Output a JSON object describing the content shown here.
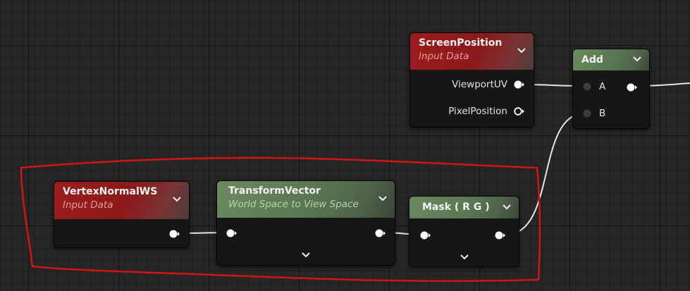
{
  "nodes": {
    "screen_position": {
      "title": "ScreenPosition",
      "subtitle": "Input Data",
      "pins": [
        "ViewportUV",
        "PixelPosition"
      ]
    },
    "add": {
      "title": "Add",
      "pins": [
        "A",
        "B"
      ]
    },
    "vertex_normal": {
      "title": "VertexNormalWS",
      "subtitle": "Input Data"
    },
    "transform_vector": {
      "title": "TransformVector",
      "subtitle": "World Space to View Space"
    },
    "mask": {
      "title": "Mask ( R G )"
    }
  },
  "icons": {
    "collapse": "chevron-down-icon",
    "output_pin": "exec-pin-filled-icon",
    "output_pin_unconnected": "exec-pin-hollow-icon",
    "input_pin_unconnected": "input-pin-icon"
  },
  "colors": {
    "input_data_header": "#9e1c1c",
    "function_header": "#6a8a60",
    "wire": "#e6e6e6",
    "selection_outline": "#d11414"
  }
}
